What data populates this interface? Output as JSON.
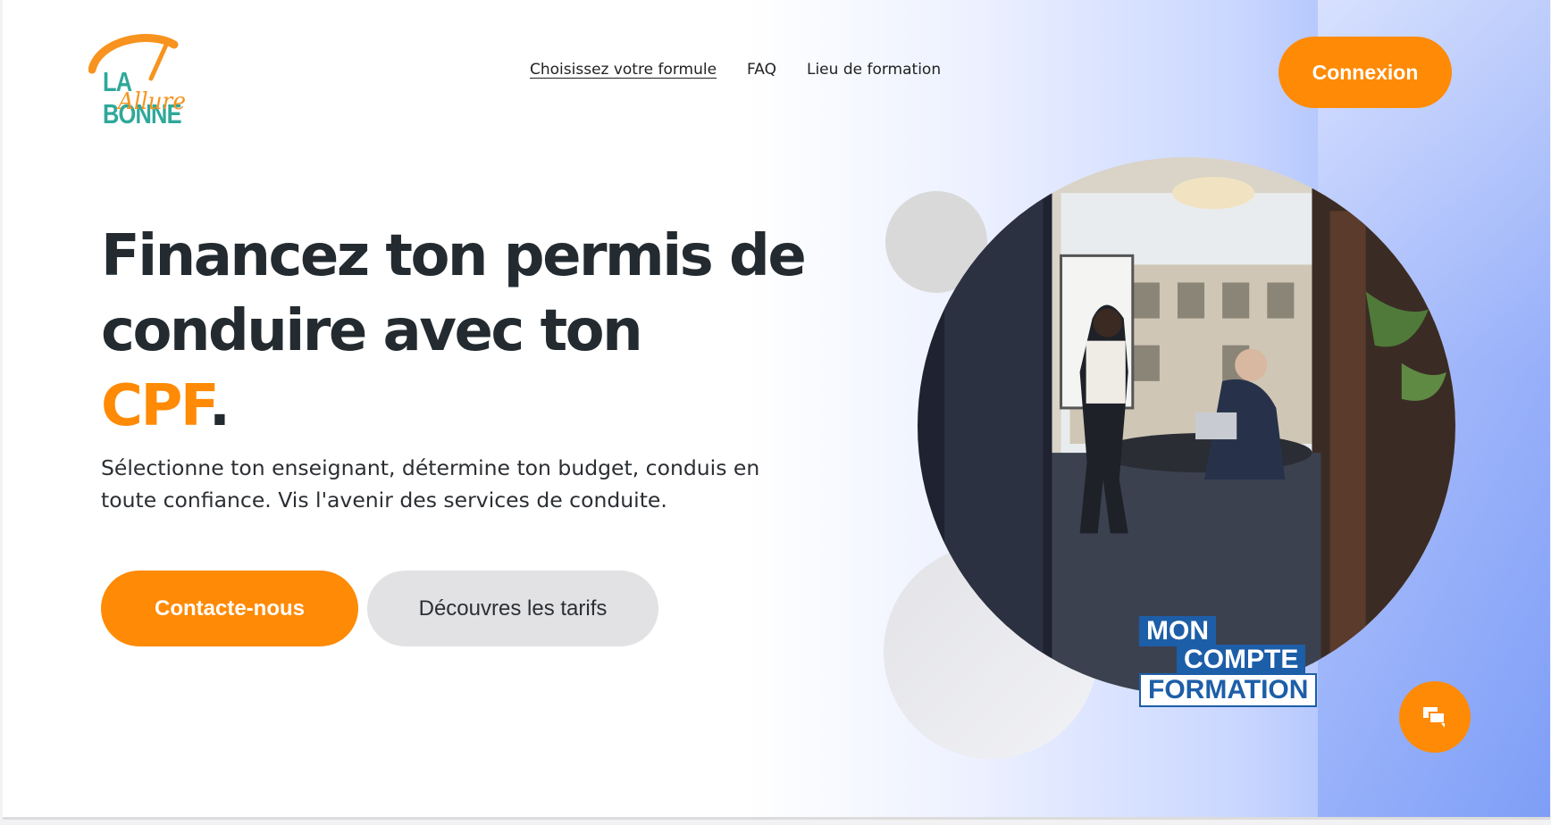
{
  "brand": {
    "logo_line1": "LA BONNE",
    "logo_line2": "Allure",
    "colors": {
      "accent": "#ff8a05",
      "teal": "#2fa89a",
      "text": "#232b30",
      "cpf_blue": "#1d5ea8"
    }
  },
  "nav": {
    "items": [
      {
        "label": "Choisissez votre formule",
        "active": true
      },
      {
        "label": "FAQ",
        "active": false
      },
      {
        "label": "Lieu de formation",
        "active": false
      }
    ],
    "login_label": "Connexion"
  },
  "hero": {
    "title_line1": "Financez ton permis de",
    "title_line2": "conduire avec ton",
    "title_accent": "CPF",
    "title_end": ".",
    "subtitle": "Sélectionne ton enseignant, détermine ton budget, conduis en toute confiance. Vis l'avenir des services de conduite.",
    "cta_primary": "Contacte-nous",
    "cta_secondary": "Découvres les tarifs"
  },
  "badge": {
    "line1": "MON",
    "line2": "COMPTE",
    "line3": "FORMATION"
  },
  "icons": {
    "logo": "speedometer-logo-icon",
    "chat": "chat-bubbles-icon"
  }
}
